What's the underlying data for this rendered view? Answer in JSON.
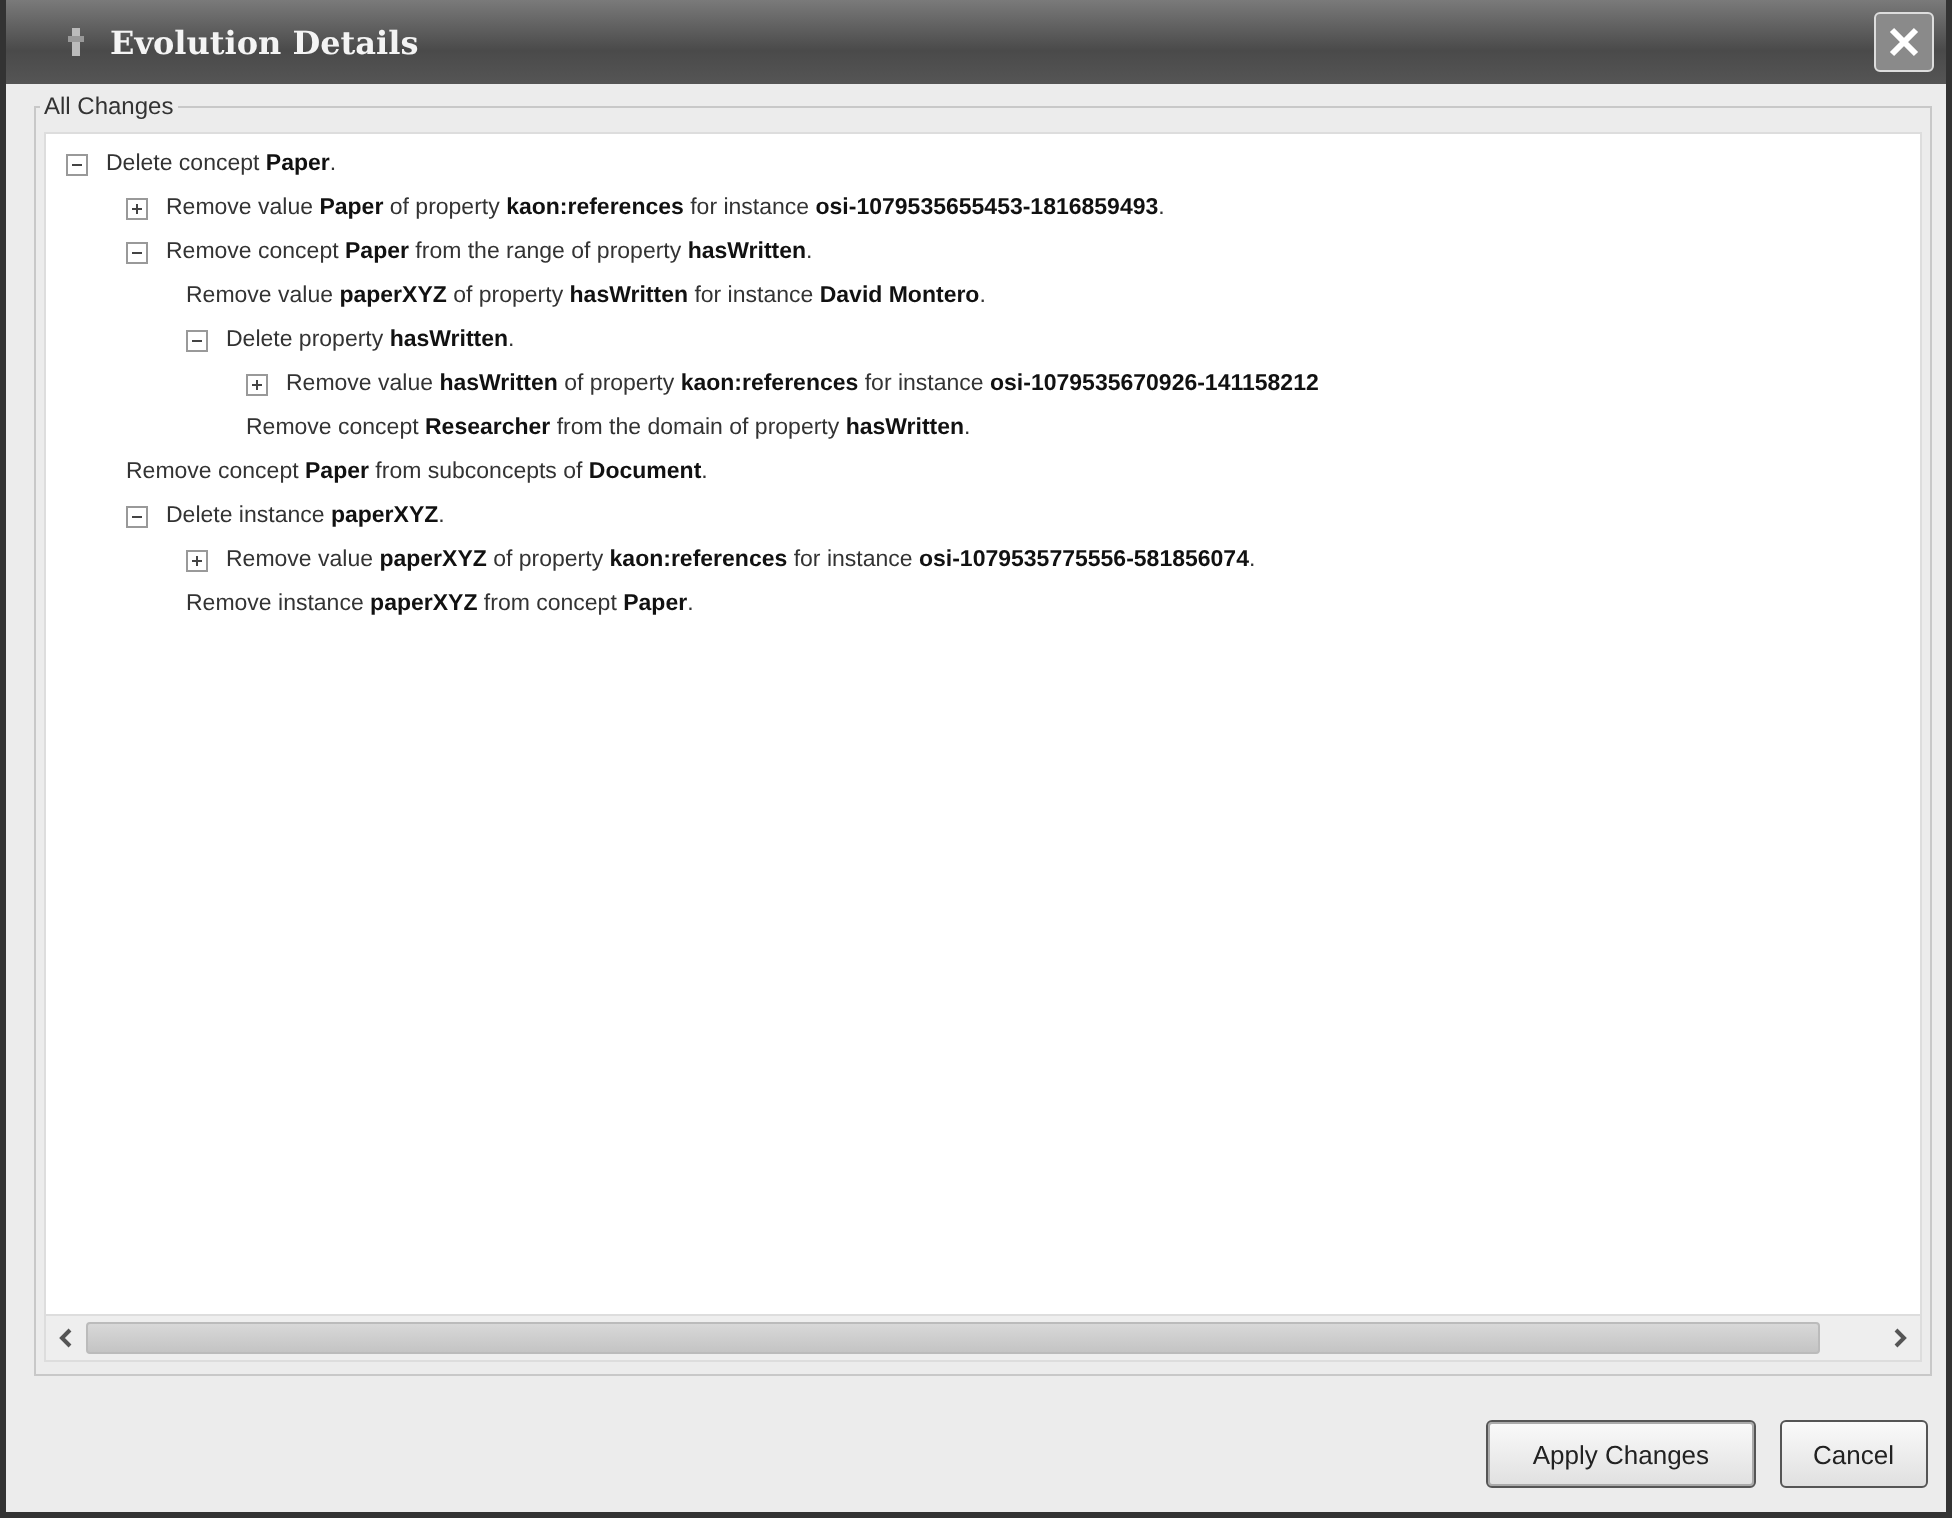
{
  "window": {
    "title": "Evolution Details"
  },
  "group": {
    "title": "All Changes"
  },
  "tree": [
    {
      "kind": "branch",
      "expanded": true,
      "text": "Delete concept **Paper**.",
      "children": [
        {
          "kind": "branch",
          "expanded": false,
          "text": "Remove value **Paper** of property **kaon:references** for instance **osi-1079535655453-1816859493**."
        },
        {
          "kind": "branch",
          "expanded": true,
          "text": "Remove concept **Paper** from the range of property **hasWritten**.",
          "children": [
            {
              "kind": "leaf",
              "text": "Remove value **paperXYZ** of property **hasWritten** for instance **David Montero**."
            },
            {
              "kind": "branch",
              "expanded": true,
              "text": "Delete property **hasWritten**.",
              "children": [
                {
                  "kind": "branch",
                  "expanded": false,
                  "text": "Remove value **hasWritten** of property **kaon:references** for instance **osi-1079535670926-141158212**"
                },
                {
                  "kind": "leaf",
                  "text": "Remove concept **Researcher** from the domain of property **hasWritten**."
                }
              ]
            }
          ]
        },
        {
          "kind": "leaf",
          "text": "Remove concept **Paper** from subconcepts of **Document**."
        },
        {
          "kind": "branch",
          "expanded": true,
          "text": "Delete instance **paperXYZ**.",
          "children": [
            {
              "kind": "branch",
              "expanded": false,
              "text": "Remove value **paperXYZ** of property **kaon:references** for instance **osi-1079535775556-581856074**."
            },
            {
              "kind": "leaf",
              "text": "Remove instance **paperXYZ** from concept **Paper**."
            }
          ]
        }
      ]
    }
  ],
  "buttons": [
    {
      "label": "Apply Changes"
    },
    {
      "label": "Cancel"
    }
  ]
}
